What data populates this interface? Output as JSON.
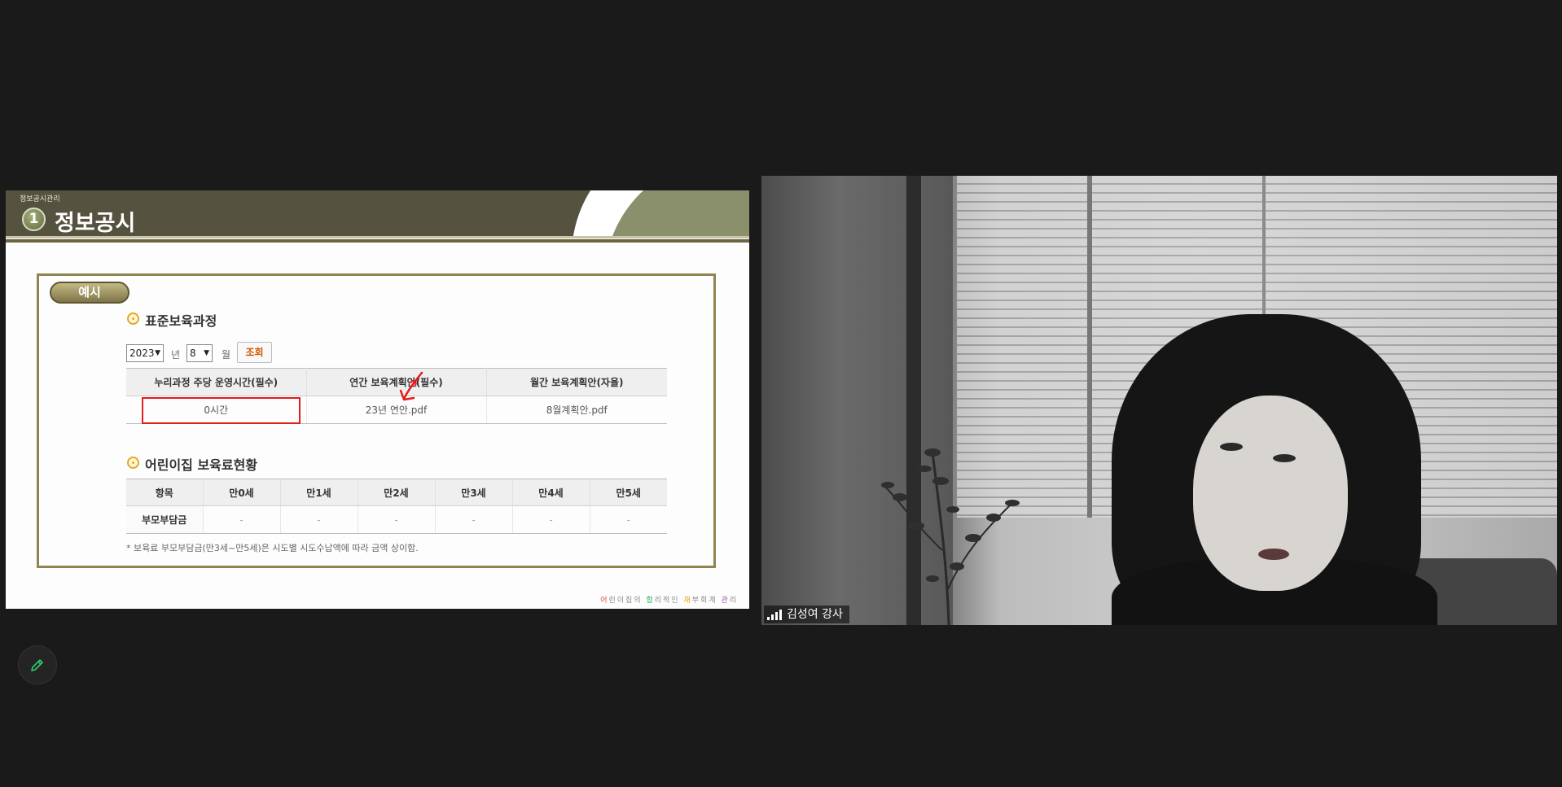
{
  "slide": {
    "breadcrumb": "정보공시관리",
    "section_number": "1",
    "title": "정보공시",
    "example_label": "예시",
    "section1": {
      "title": "표준보육과정",
      "year_value": "2023",
      "year_label": "년",
      "month_value": "8",
      "month_label": "월",
      "query_button": "조회",
      "table": {
        "headers": [
          "누리과정 주당 운영시간(필수)",
          "연간 보육계획안(필수)",
          "월간 보육계획안(자율)"
        ],
        "row": [
          "0시간",
          "23년 연안.pdf",
          "8월계획안.pdf"
        ]
      }
    },
    "section2": {
      "title": "어린이집 보육료현황",
      "table": {
        "headers": [
          "항목",
          "만0세",
          "만1세",
          "만2세",
          "만3세",
          "만4세",
          "만5세"
        ],
        "row": [
          "부모부담금",
          "-",
          "-",
          "-",
          "-",
          "-",
          "-"
        ]
      }
    },
    "note": "* 보육료 부모부담금(만3세~만5세)은 시도별 시도수납액에 따라 금액 상이함.",
    "footer": {
      "parts": [
        "어",
        "린이집의 ",
        "합",
        "리적인 ",
        "재",
        "부회계 ",
        "관",
        "리"
      ],
      "colors": [
        "#e74c3c",
        "#888888",
        "#27ae60",
        "#888888",
        "#f39c12",
        "#888888",
        "#9b59b6",
        "#888888"
      ]
    }
  },
  "video": {
    "participant_name": "김성여 강사",
    "signal_icon": "signal-bars-icon"
  },
  "toolbar": {
    "annotate_icon": "pencil-icon"
  },
  "colors": {
    "background": "#1a1a1a",
    "header_olive": "#55523f",
    "frame_border": "#8f8551",
    "highlight_red": "#e11d1d",
    "pencil_green": "#2ecc71"
  }
}
